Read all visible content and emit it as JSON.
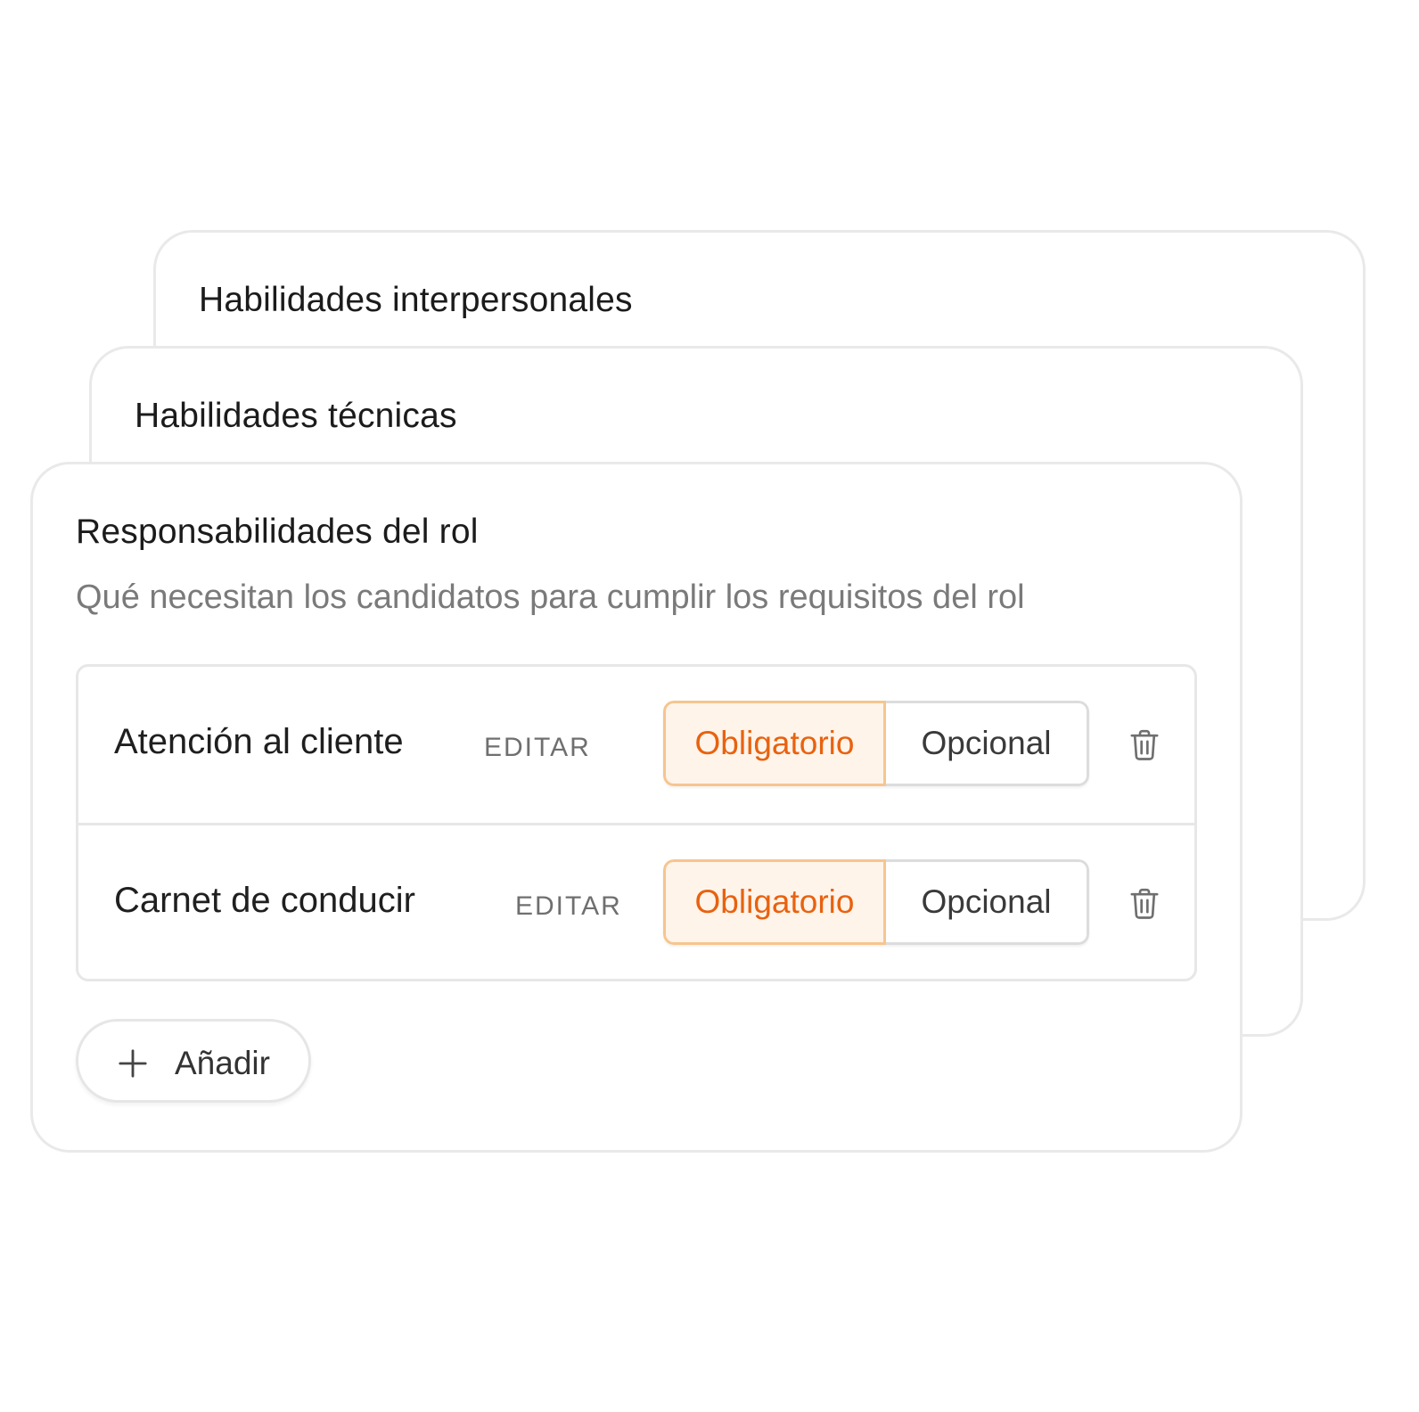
{
  "cards": {
    "back": {
      "title": "Habilidades interpersonales"
    },
    "middle": {
      "title": "Habilidades técnicas"
    },
    "front": {
      "title": "Responsabilidades del rol",
      "subtitle": "Qué necesitan los candidatos para cumplir los requisitos del rol",
      "items": [
        {
          "label": "Atención al cliente",
          "edit_label": "EDITAR",
          "options": [
            "Obligatorio",
            "Opcional"
          ],
          "selected": "Obligatorio",
          "delete_icon": "trash-icon"
        },
        {
          "label": "Carnet de conducir",
          "edit_label": "EDITAR",
          "options": [
            "Obligatorio",
            "Opcional"
          ],
          "selected": "Obligatorio",
          "delete_icon": "trash-icon"
        }
      ],
      "add_button": {
        "label": "Añadir",
        "icon": "plus-icon"
      }
    }
  },
  "colors": {
    "accent": "#e8620f",
    "accent_bg": "#fff4ea",
    "accent_border": "#f6c58f",
    "border": "#e7e7e7",
    "muted_text": "#7a7a7a"
  }
}
